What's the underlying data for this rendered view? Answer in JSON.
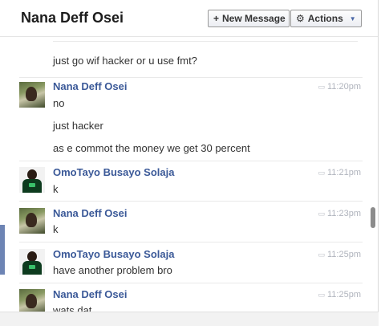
{
  "header": {
    "title": "Nana Deff Osei",
    "new_message_label": "New Message",
    "actions_label": "Actions"
  },
  "thread": {
    "partial_line": "just go wif hacker or u use fmt?",
    "messages": [
      {
        "sender": "Nana Deff Osei",
        "time": "11:20pm",
        "lines": [
          "no",
          "just hacker",
          "as e commot the money we get 30 percent"
        ]
      },
      {
        "sender": "OmoTayo Busayo Solaja",
        "time": "11:21pm",
        "lines": [
          "k"
        ]
      },
      {
        "sender": "Nana Deff Osei",
        "time": "11:23pm",
        "lines": [
          "k"
        ]
      },
      {
        "sender": "OmoTayo Busayo Solaja",
        "time": "11:25pm",
        "lines": [
          "have another problem bro"
        ]
      },
      {
        "sender": "Nana Deff Osei",
        "time": "11:25pm",
        "lines": [
          "wats dat"
        ]
      }
    ]
  },
  "colors": {
    "sender_link": "#3b5998",
    "timestamp": "#b0b4bd",
    "accent": "#6d84b4"
  },
  "icons": {
    "new_message": "plus-icon",
    "actions": "gear-icon",
    "dropdown": "chevron-down-icon",
    "timestamp": "speech-bubble-icon"
  }
}
